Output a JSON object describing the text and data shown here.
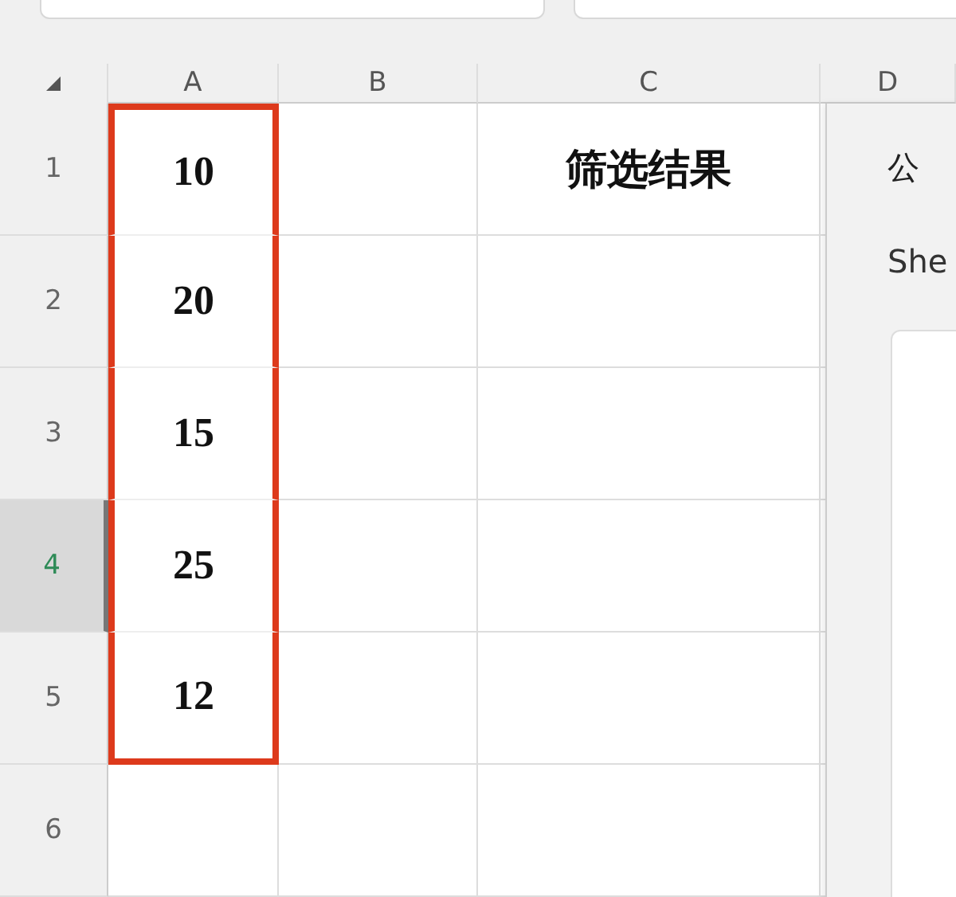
{
  "columns": [
    {
      "label": "A"
    },
    {
      "label": "B"
    },
    {
      "label": "C"
    },
    {
      "label": "D"
    }
  ],
  "rows": [
    {
      "label": "1",
      "selected": false,
      "highlighted": true,
      "a_value": "10",
      "c_value": "筛选结果"
    },
    {
      "label": "2",
      "selected": false,
      "highlighted": true,
      "a_value": "20"
    },
    {
      "label": "3",
      "selected": false,
      "highlighted": true,
      "a_value": "15"
    },
    {
      "label": "4",
      "selected": true,
      "highlighted": true,
      "a_value": "25"
    },
    {
      "label": "5",
      "selected": false,
      "highlighted": true,
      "a_value": "12"
    },
    {
      "label": "6",
      "selected": false,
      "highlighted": false
    }
  ],
  "formula_panel": {
    "title": "公",
    "sheet_label": "She"
  }
}
